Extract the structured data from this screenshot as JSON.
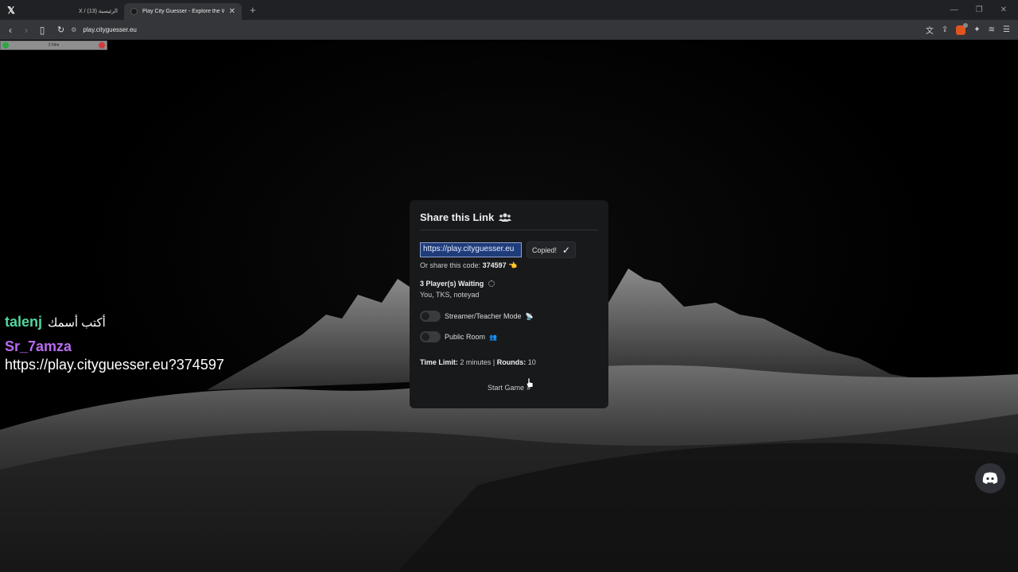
{
  "browser": {
    "tabs": [
      {
        "label": "X / الرئيسية (13)",
        "active": false
      },
      {
        "label": "Play City Guesser - Explore the W",
        "active": true
      }
    ],
    "url": "play.cityguesser.eu"
  },
  "mini_window": {
    "label": "2 Film"
  },
  "overlay": {
    "name1": "talenj",
    "arabic": "أكتب أسمك",
    "name2": "Sr_7amza",
    "link": "https://play.cityguesser.eu?374597"
  },
  "modal": {
    "title": "Share this Link",
    "link_value": "https://play.cityguesser.eu",
    "copied_label": "Copied!",
    "share_code_prefix": "Or share this code:",
    "share_code": "374597",
    "players_waiting": "3 Player(s) Waiting",
    "player_names": "You, TKS, noteyad",
    "toggle_streamer": "Streamer/Teacher Mode",
    "toggle_public": "Public Room",
    "time_limit_label": "Time Limit:",
    "time_limit_value": "2 minutes",
    "separator": "|",
    "rounds_label": "Rounds:",
    "rounds_value": "10",
    "start_label": "Start Game"
  },
  "colors": {
    "accent_name1": "#53d6a0",
    "accent_name2": "#b76cf0",
    "modal_bg": "#18191b"
  },
  "icons": [
    "x-logo-icon",
    "back-icon",
    "forward-icon",
    "bookmark-icon",
    "reload-icon",
    "site-settings-icon",
    "translate-icon",
    "share-icon",
    "brave-shields-icon",
    "extensions-icon",
    "menu-icon",
    "users-icon",
    "checkmark-icon",
    "pointing-hand-icon",
    "spinner-icon",
    "broadcast-icon",
    "double-chevron-icon",
    "discord-icon"
  ]
}
